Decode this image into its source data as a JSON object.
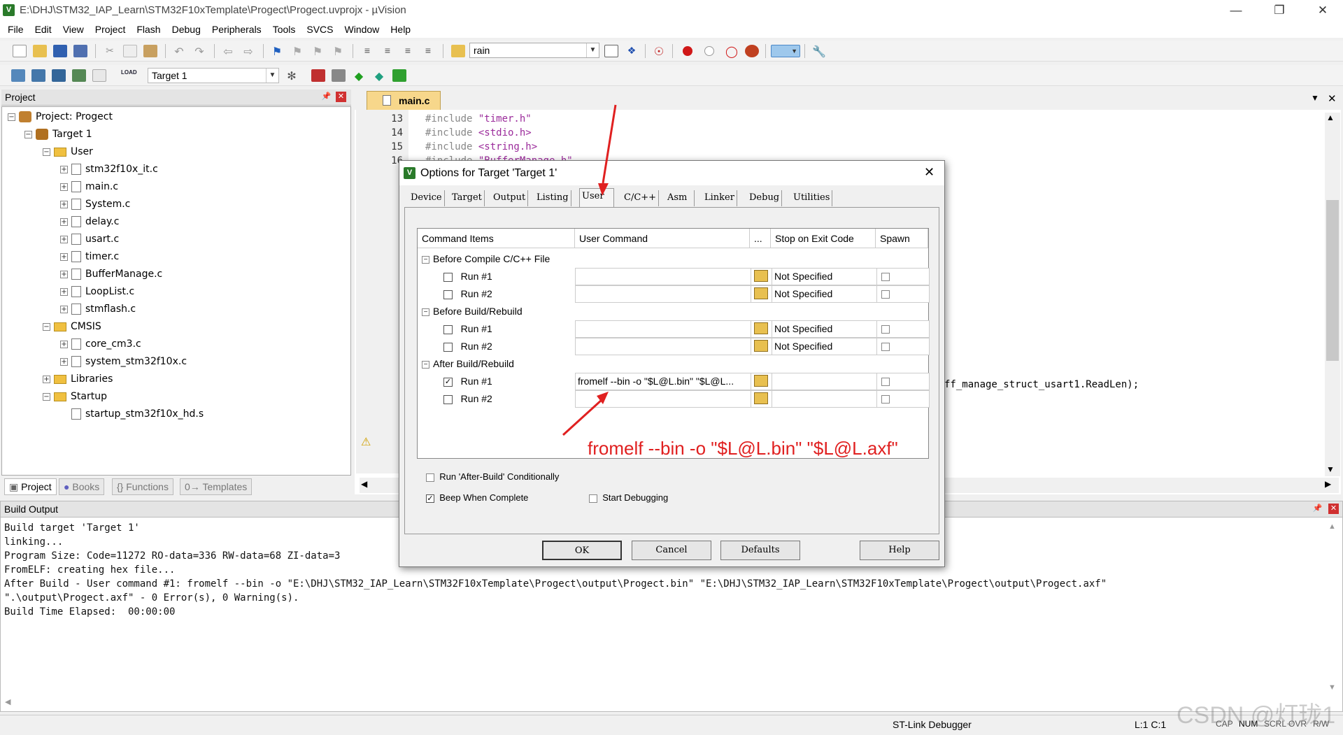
{
  "window": {
    "title": "E:\\DHJ\\STM32_IAP_Learn\\STM32F10xTemplate\\Progect\\Progect.uvprojx - µVision",
    "app_icon": "V"
  },
  "menu": [
    "File",
    "Edit",
    "View",
    "Project",
    "Flash",
    "Debug",
    "Peripherals",
    "Tools",
    "SVCS",
    "Window",
    "Help"
  ],
  "toolbar": {
    "find_combo": "rain",
    "target_combo": "Target 1",
    "load_label": "LOAD"
  },
  "project_panel": {
    "title": "Project",
    "root": "Project: Progect",
    "target": "Target 1",
    "groups": [
      {
        "name": "User",
        "files": [
          "stm32f10x_it.c",
          "main.c",
          "System.c",
          "delay.c",
          "usart.c",
          "timer.c",
          "BufferManage.c",
          "LoopList.c",
          "stmflash.c"
        ]
      },
      {
        "name": "CMSIS",
        "files": [
          "core_cm3.c",
          "system_stm32f10x.c"
        ]
      },
      {
        "name": "Libraries",
        "files": []
      },
      {
        "name": "Startup",
        "files": [
          "startup_stm32f10x_hd.s"
        ]
      }
    ]
  },
  "bottom_tabs": [
    "Project",
    "Books",
    "Functions",
    "Templates"
  ],
  "editor": {
    "tab": "main.c",
    "lines": [
      {
        "num": "13",
        "pp": "#include ",
        "str": "\"timer.h\""
      },
      {
        "num": "14",
        "pp": "#include ",
        "str": "<stdio.h>"
      },
      {
        "num": "15",
        "pp": "#include ",
        "str": "<string.h>"
      },
      {
        "num": "16",
        "pp": "#include ",
        "str": "\"BufferManage.h\""
      }
    ],
    "partial_line": "ff_manage_struct_usart1.ReadLen);"
  },
  "build_output": {
    "title": "Build Output",
    "lines": [
      "Build target 'Target 1'",
      "linking...",
      "Program Size: Code=11272 RO-data=336 RW-data=68 ZI-data=3",
      "FromELF: creating hex file...",
      "After Build - User command #1: fromelf --bin -o \"E:\\DHJ\\STM32_IAP_Learn\\STM32F10xTemplate\\Progect\\output\\Progect.bin\" \"E:\\DHJ\\STM32_IAP_Learn\\STM32F10xTemplate\\Progect\\output\\Progect.axf\"",
      "\".\\output\\Progect.axf\" - 0 Error(s), 0 Warning(s).",
      "Build Time Elapsed:  00:00:00"
    ]
  },
  "status": {
    "debugger": "ST-Link Debugger",
    "position": "L:1 C:1",
    "caps": "CAP",
    "num": "NUM",
    "scrl": "SCRL",
    "ovr": "OVR",
    "rw": "R/W"
  },
  "watermark": "CSDN @灯珑1",
  "dialog": {
    "title": "Options for Target 'Target 1'",
    "tabs": [
      "Device",
      "Target",
      "Output",
      "Listing",
      "User",
      "C/C++",
      "Asm",
      "Linker",
      "Debug",
      "Utilities"
    ],
    "active_tab": "User",
    "headers": {
      "items": "Command Items",
      "command": "User Command",
      "dots": "...",
      "stop": "Stop on Exit Code",
      "spawn": "Spawn"
    },
    "sections": [
      {
        "name": "Before Compile C/C++ File",
        "rows": [
          {
            "label": "Run #1",
            "checked": "",
            "command": "",
            "exit": "Not Specified"
          },
          {
            "label": "Run #2",
            "checked": "",
            "command": "",
            "exit": "Not Specified"
          }
        ]
      },
      {
        "name": "Before Build/Rebuild",
        "rows": [
          {
            "label": "Run #1",
            "checked": "",
            "command": "",
            "exit": "Not Specified"
          },
          {
            "label": "Run #2",
            "checked": "",
            "command": "",
            "exit": "Not Specified"
          }
        ]
      },
      {
        "name": "After Build/Rebuild",
        "rows": [
          {
            "label": "Run #1",
            "checked": "✓",
            "command": "fromelf --bin -o \"$L@L.bin\" \"$L@L...",
            "exit": ""
          },
          {
            "label": "Run #2",
            "checked": "",
            "command": "",
            "exit": ""
          }
        ]
      }
    ],
    "options": {
      "run_conditional": "Run 'After-Build' Conditionally",
      "beep": "Beep When Complete",
      "beep_check": "✓",
      "start_debug": "Start Debugging"
    },
    "buttons": {
      "ok": "OK",
      "cancel": "Cancel",
      "defaults": "Defaults",
      "help": "Help"
    }
  },
  "annotation": {
    "text": "fromelf --bin -o \"$L@L.bin\" \"$L@L.axf\"",
    "color": "#e02020"
  }
}
